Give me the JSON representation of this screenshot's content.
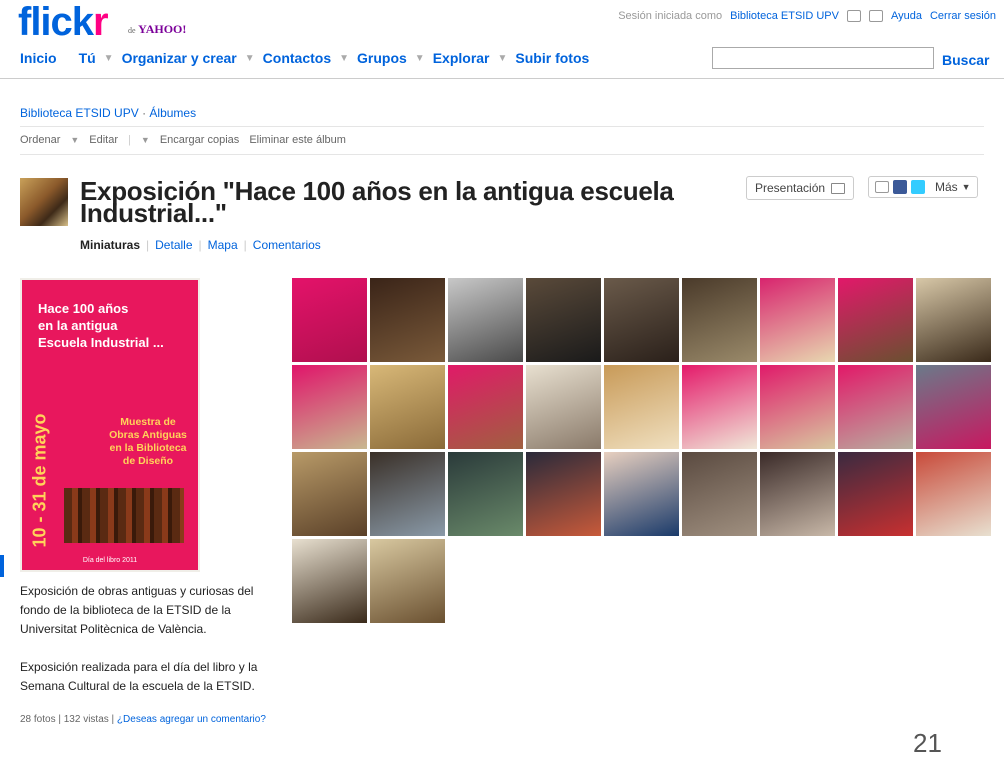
{
  "brand": {
    "logo_part1": "flick",
    "logo_part2": "r",
    "sub": "de",
    "yahoo": "YAHOO!"
  },
  "top": {
    "session_text": "Sesión iniciada como",
    "user": "Biblioteca ETSID UPV",
    "help": "Ayuda",
    "logout": "Cerrar sesión"
  },
  "nav": {
    "items": [
      "Inicio",
      "Tú",
      "Organizar y crear",
      "Contactos",
      "Grupos",
      "Explorar",
      "Subir fotos"
    ],
    "search_button": "Buscar",
    "search_placeholder": ""
  },
  "breadcrumb": {
    "owner": "Biblioteca ETSID UPV",
    "sep": "·",
    "section": "Álbumes"
  },
  "toolbar": {
    "sort": "Ordenar",
    "edit": "Editar",
    "order_prints": "Encargar copias",
    "delete_album": "Eliminar este álbum"
  },
  "album": {
    "title": "Exposición \"Hace 100 años en la antigua escuela Industrial...\"",
    "views": {
      "thumbnails": "Miniaturas",
      "detail": "Detalle",
      "map": "Mapa",
      "comments": "Comentarios"
    },
    "presentation": "Presentación",
    "more": "Más",
    "description1": "Exposición de obras antiguas y curiosas del fondo de la biblioteca de la ETSID de la Universitat Politècnica de València.",
    "description2": "Exposición realizada para el día del libro y la Semana Cultural de la escuela de la ETSID.",
    "stats": "28 fotos | 132 vistas |",
    "comment_link": "¿Deseas agregar un comentario?"
  },
  "poster": {
    "line1": "Hace 100 años",
    "line2": "en la antigua",
    "line3": "Escuela Industrial ...",
    "vertical": "10 - 31 de mayo",
    "muestra": "Muestra de Obras Antiguas en la Biblioteca de Diseño",
    "footer": "Día del libro 2011"
  },
  "photos": [
    {
      "c1": "#e4126a",
      "c2": "#b0104e"
    },
    {
      "c1": "#3a2418",
      "c2": "#7a5a3a"
    },
    {
      "c1": "#c8c8c8",
      "c2": "#4a4a4a"
    },
    {
      "c1": "#5a4a3a",
      "c2": "#1a1a1a"
    },
    {
      "c1": "#6a5a4a",
      "c2": "#2a201a"
    },
    {
      "c1": "#4a3a2a",
      "c2": "#9a8a6a"
    },
    {
      "c1": "#d8246e",
      "c2": "#e8d8b0"
    },
    {
      "c1": "#e2186a",
      "c2": "#6a5030"
    },
    {
      "c1": "#d8c8a8",
      "c2": "#3a2a1a"
    },
    {
      "c1": "#e0146a",
      "c2": "#c8b890"
    },
    {
      "c1": "#d8b878",
      "c2": "#8a6a38"
    },
    {
      "c1": "#e01a68",
      "c2": "#a06040"
    },
    {
      "c1": "#e8e0d0",
      "c2": "#8a7a6a"
    },
    {
      "c1": "#c89a58",
      "c2": "#f0e0c0"
    },
    {
      "c1": "#e41a6a",
      "c2": "#f0e8d8"
    },
    {
      "c1": "#e01a6a",
      "c2": "#d8c8a0"
    },
    {
      "c1": "#e21868",
      "c2": "#b8b0a0"
    },
    {
      "c1": "#6a7a8a",
      "c2": "#c81860"
    },
    {
      "c1": "#b89a68",
      "c2": "#5a4028"
    },
    {
      "c1": "#3a3028",
      "c2": "#8a9aa8"
    },
    {
      "c1": "#2a3a3a",
      "c2": "#6a8a6a"
    },
    {
      "c1": "#2a2a3a",
      "c2": "#c85a3a"
    },
    {
      "c1": "#e8d0c0",
      "c2": "#1a3a6a"
    },
    {
      "c1": "#5a4a40",
      "c2": "#a09080"
    },
    {
      "c1": "#3a2a28",
      "c2": "#c8b8a8"
    },
    {
      "c1": "#3a2a40",
      "c2": "#c83030"
    },
    {
      "c1": "#c84a3a",
      "c2": "#e8e0d0"
    },
    {
      "c1": "#e8e0d0",
      "c2": "#3a2a1a"
    },
    {
      "c1": "#d8c8a0",
      "c2": "#6a5030"
    }
  ],
  "page_number": "21"
}
